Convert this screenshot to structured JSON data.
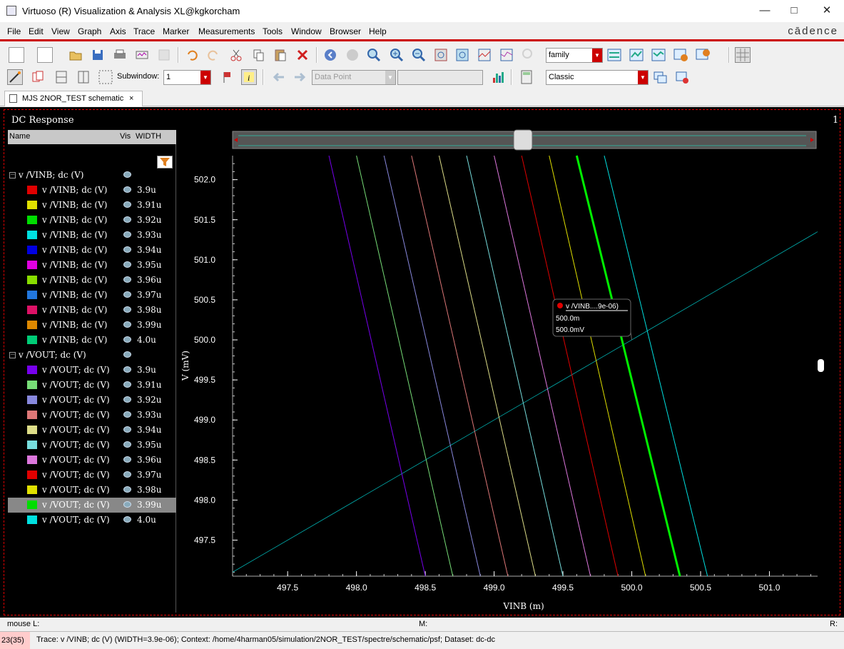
{
  "window": {
    "title": "Virtuoso (R) Visualization & Analysis XL@kgkorcham"
  },
  "menu": [
    "File",
    "Edit",
    "View",
    "Graph",
    "Axis",
    "Trace",
    "Marker",
    "Measurements",
    "Tools",
    "Window",
    "Browser",
    "Help"
  ],
  "brand": "cādence",
  "toolbar1": {
    "family_select": "family"
  },
  "toolbar2": {
    "subwindow_label": "Subwindow:",
    "subwindow_value": "1",
    "data_point_select": "Data Point",
    "style_select": "Classic"
  },
  "tab": {
    "label": "MJS 2NOR_TEST schematic",
    "close": "×"
  },
  "panel": {
    "title": "DC Response",
    "page_number": "1"
  },
  "trace_table": {
    "headers": [
      "Name",
      "Vis",
      "WIDTH"
    ],
    "groups": [
      {
        "label": "v /VINB; dc (V)",
        "items": [
          {
            "name": "v /VINB; dc (V)",
            "width": "3.9u",
            "color": "#e00000"
          },
          {
            "name": "v /VINB; dc (V)",
            "width": "3.91u",
            "color": "#e0e000"
          },
          {
            "name": "v /VINB; dc (V)",
            "width": "3.92u",
            "color": "#00dd00"
          },
          {
            "name": "v /VINB; dc (V)",
            "width": "3.93u",
            "color": "#00e0e0"
          },
          {
            "name": "v /VINB; dc (V)",
            "width": "3.94u",
            "color": "#0000e0"
          },
          {
            "name": "v /VINB; dc (V)",
            "width": "3.95u",
            "color": "#e000e0"
          },
          {
            "name": "v /VINB; dc (V)",
            "width": "3.96u",
            "color": "#88dd00"
          },
          {
            "name": "v /VINB; dc (V)",
            "width": "3.97u",
            "color": "#2277dd"
          },
          {
            "name": "v /VINB; dc (V)",
            "width": "3.98u",
            "color": "#dd1166"
          },
          {
            "name": "v /VINB; dc (V)",
            "width": "3.99u",
            "color": "#dd8800"
          },
          {
            "name": "v /VINB; dc (V)",
            "width": "4.0u",
            "color": "#00cc77"
          }
        ]
      },
      {
        "label": "v /VOUT; dc (V)",
        "items": [
          {
            "name": "v /VOUT; dc (V)",
            "width": "3.9u",
            "color": "#7700ee"
          },
          {
            "name": "v /VOUT; dc (V)",
            "width": "3.91u",
            "color": "#77dd77"
          },
          {
            "name": "v /VOUT; dc (V)",
            "width": "3.92u",
            "color": "#8888dd"
          },
          {
            "name": "v /VOUT; dc (V)",
            "width": "3.93u",
            "color": "#dd7777"
          },
          {
            "name": "v /VOUT; dc (V)",
            "width": "3.94u",
            "color": "#dddd88"
          },
          {
            "name": "v /VOUT; dc (V)",
            "width": "3.95u",
            "color": "#77dddd"
          },
          {
            "name": "v /VOUT; dc (V)",
            "width": "3.96u",
            "color": "#dd77dd"
          },
          {
            "name": "v /VOUT; dc (V)",
            "width": "3.97u",
            "color": "#e00000"
          },
          {
            "name": "v /VOUT; dc (V)",
            "width": "3.98u",
            "color": "#e0e000"
          },
          {
            "name": "v /VOUT; dc (V)",
            "width": "3.99u",
            "color": "#00dd00",
            "selected": true
          },
          {
            "name": "v /VOUT; dc (V)",
            "width": "4.0u",
            "color": "#00e0e0"
          }
        ]
      }
    ]
  },
  "marker": {
    "label": "v /VINB....9e-06)",
    "x": "500.0m",
    "y": "500.0mV"
  },
  "status": {
    "mouse_l": "mouse L:",
    "mouse_m": "M:",
    "mouse_r": "R:",
    "count": "23(35)",
    "message": "Trace: v /VINB; dc (V) (WIDTH=3.9e-06); Context: /home/4harman05/simulation/2NOR_TEST/spectre/schematic/psf; Dataset: dc-dc"
  },
  "chart_data": {
    "type": "line",
    "xlabel": "VINB (m)",
    "ylabel": "V (mV)",
    "xlim": [
      497.1,
      501.35
    ],
    "ylim": [
      497.05,
      502.3
    ],
    "xticks": [
      "497.5",
      "498.0",
      "498.5",
      "499.0",
      "499.5",
      "500.0",
      "500.5",
      "501.0"
    ],
    "yticks": [
      "502.0",
      "501.5",
      "501.0",
      "500.5",
      "500.0",
      "499.5",
      "499.0",
      "498.5",
      "498.0",
      "497.5"
    ],
    "series": [
      {
        "name": "v /VINB; dc (V)",
        "x": [
          497.1,
          501.35
        ],
        "y": [
          497.1,
          501.35
        ],
        "color": "#00b0b0",
        "width": 0.8
      },
      {
        "name": "v /VOUT; dc (V)",
        "x": [
          497.8,
          498.5
        ],
        "y": [
          502.3,
          497.05
        ],
        "color": "#7700ee",
        "width": 1
      },
      {
        "name": "v /VOUT; dc (V)",
        "x": [
          498.0,
          498.7
        ],
        "y": [
          502.3,
          497.05
        ],
        "color": "#77dd77",
        "width": 1
      },
      {
        "name": "v /VOUT; dc (V)",
        "x": [
          498.2,
          498.9
        ],
        "y": [
          502.3,
          497.05
        ],
        "color": "#8888dd",
        "width": 1
      },
      {
        "name": "v /VOUT; dc (V)",
        "x": [
          498.4,
          499.1
        ],
        "y": [
          502.3,
          497.05
        ],
        "color": "#dd7777",
        "width": 1
      },
      {
        "name": "v /VOUT; dc (V)",
        "x": [
          498.6,
          499.3
        ],
        "y": [
          502.3,
          497.05
        ],
        "color": "#dddd88",
        "width": 1
      },
      {
        "name": "v /VOUT; dc (V)",
        "x": [
          498.8,
          499.5
        ],
        "y": [
          502.3,
          497.05
        ],
        "color": "#77dddd",
        "width": 1
      },
      {
        "name": "v /VOUT; dc (V)",
        "x": [
          499.0,
          499.7
        ],
        "y": [
          502.3,
          497.05
        ],
        "color": "#dd77dd",
        "width": 1
      },
      {
        "name": "v /VOUT; dc (V)",
        "x": [
          499.2,
          499.9
        ],
        "y": [
          502.3,
          497.05
        ],
        "color": "#e00000",
        "width": 1
      },
      {
        "name": "v /VOUT; dc (V)",
        "x": [
          499.4,
          500.1
        ],
        "y": [
          502.3,
          497.05
        ],
        "color": "#e0e000",
        "width": 1
      },
      {
        "name": "v /VOUT; dc (V)",
        "x": [
          499.6,
          500.35
        ],
        "y": [
          502.3,
          497.05
        ],
        "color": "#00ee00",
        "width": 3
      },
      {
        "name": "v /VOUT; dc (V)",
        "x": [
          499.8,
          500.55
        ],
        "y": [
          502.3,
          497.05
        ],
        "color": "#00e0e0",
        "width": 1
      }
    ]
  }
}
